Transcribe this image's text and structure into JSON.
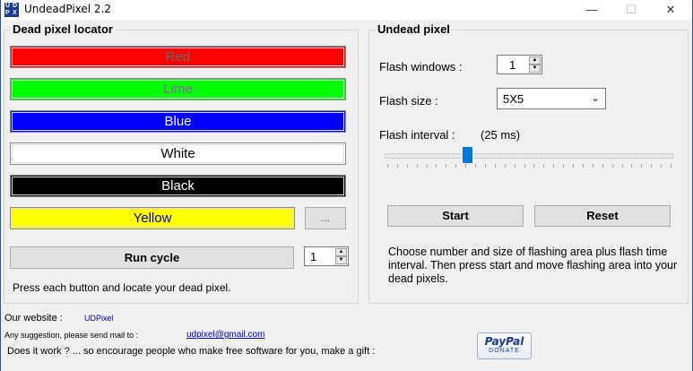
{
  "window": {
    "title": "UndeadPixel 2.2",
    "icon_text": [
      "U",
      "D",
      "P",
      "X"
    ],
    "minimize": "—",
    "maximize": "☐",
    "close": "✕"
  },
  "locator": {
    "title": "Dead pixel locator",
    "buttons": [
      {
        "label": "Red",
        "bg": "#ff0000",
        "fg": "#666666"
      },
      {
        "label": "Lime",
        "bg": "#00ff00",
        "fg": "#9b59b6"
      },
      {
        "label": "Blue",
        "bg": "#0000ff",
        "fg": "#ffffff"
      },
      {
        "label": "White",
        "bg": "#ffffff",
        "fg": "#000000"
      },
      {
        "label": "Black",
        "bg": "#000000",
        "fg": "#ffffff"
      },
      {
        "label": "Yellow",
        "bg": "#ffff00",
        "fg": "#0000aa"
      }
    ],
    "custom_color_label": "...",
    "run_cycle_label": "Run cycle",
    "cycle_count": "1",
    "instructions": "Press each button and locate your dead pixel."
  },
  "undead": {
    "title": "Undead pixel",
    "flash_windows_label": "Flash windows :",
    "flash_windows_value": "1",
    "flash_size_label": "Flash size :",
    "flash_size_value": "5X5",
    "flash_interval_label": "Flash interval :",
    "flash_interval_value": "(25 ms)",
    "slider_fraction": 0.29,
    "start_label": "Start",
    "reset_label": "Reset",
    "description": "Choose number and size of flashing area plus flash time interval. Then press start and move flashing area into your dead pixels."
  },
  "footer": {
    "website_label": "Our website :",
    "website_link": "UDPixel",
    "suggestion_label": "Any suggestion, please send mail to :",
    "email_link": "udpixel@gmail.com",
    "gift_text": "Does it work ? ... so encourage people who make free software for you, make a gift :",
    "paypal_label": "PayPal",
    "donate_label": "DONATE"
  }
}
